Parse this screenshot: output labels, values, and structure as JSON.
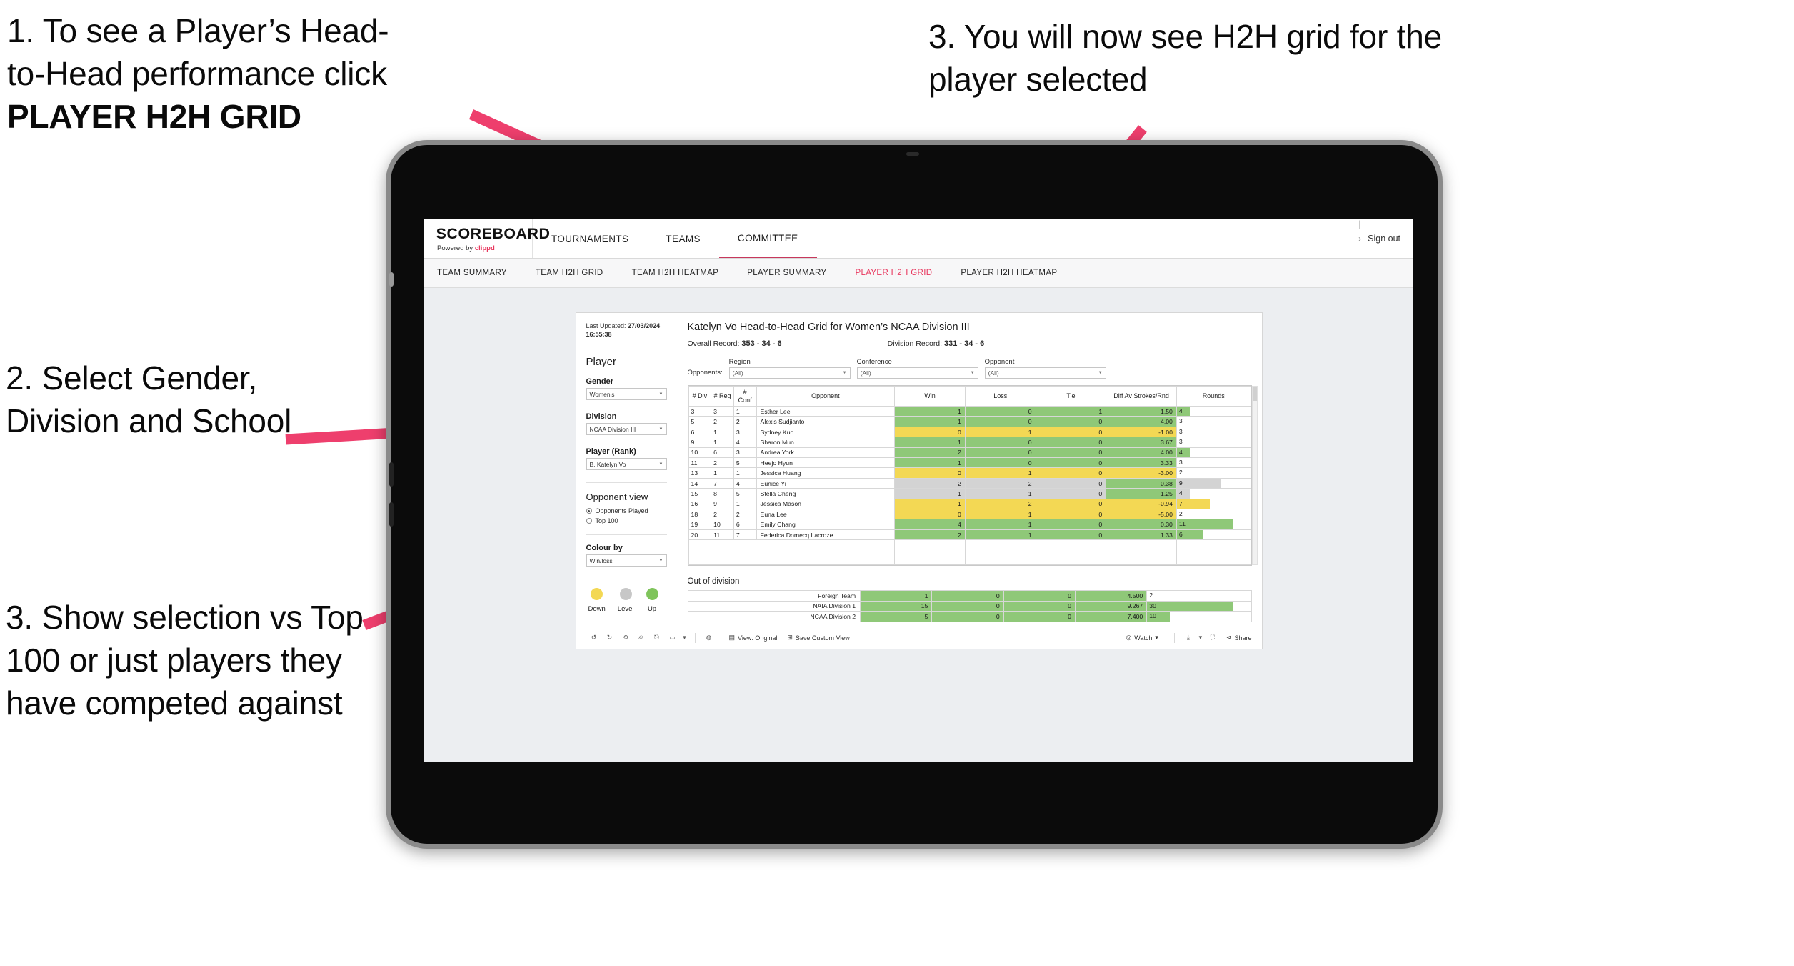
{
  "annotations": {
    "a1_line1": "1. To see a Player’s Head-",
    "a1_line2": "to-Head performance click",
    "a1_bold": "PLAYER H2H GRID",
    "a2": "2. Select Gender, Division and School",
    "a3": "3. Show selection vs Top 100 or just players they have competed against",
    "a4": "3. You will now see H2H grid for the player selected"
  },
  "app": {
    "brand_name": "SCOREBOARD",
    "brand_powered_prefix": "Powered by ",
    "brand_powered_name": "clippd",
    "top_nav": [
      {
        "label": "TOURNAMENTS",
        "active": false
      },
      {
        "label": "TEAMS",
        "active": false
      },
      {
        "label": "COMMITTEE",
        "active": true
      }
    ],
    "sign_out": "Sign out",
    "sub_nav": [
      {
        "label": "TEAM SUMMARY",
        "active": false
      },
      {
        "label": "TEAM H2H GRID",
        "active": false
      },
      {
        "label": "TEAM H2H HEATMAP",
        "active": false
      },
      {
        "label": "PLAYER SUMMARY",
        "active": false
      },
      {
        "label": "PLAYER H2H GRID",
        "active": true
      },
      {
        "label": "PLAYER H2H HEATMAP",
        "active": false
      }
    ],
    "accent_color": "#e8365d"
  },
  "sidebar": {
    "last_updated_label": "Last Updated: ",
    "last_updated_value": "27/03/2024 16:55:38",
    "player_section_title": "Player",
    "gender_label": "Gender",
    "gender_value": "Women's",
    "division_label": "Division",
    "division_value": "NCAA Division III",
    "player_rank_label": "Player (Rank)",
    "player_rank_value": "B. Katelyn Vo",
    "opponent_view_title": "Opponent view",
    "opponent_view_options": [
      {
        "label": "Opponents Played",
        "selected": true
      },
      {
        "label": "Top 100",
        "selected": false
      }
    ],
    "colour_by_label": "Colour by",
    "colour_by_value": "Win/loss",
    "legend": [
      {
        "label": "Down",
        "color": "#f3d854"
      },
      {
        "label": "Level",
        "color": "#c7c7c7"
      },
      {
        "label": "Up",
        "color": "#7fc45b"
      }
    ]
  },
  "main": {
    "title": "Katelyn Vo Head-to-Head Grid for Women’s NCAA Division III",
    "overall_record_label": "Overall Record: ",
    "overall_record_value": "353 -  34 - 6",
    "division_record_label": "Division Record: ",
    "division_record_value": "331 -  34 - 6",
    "opponents_label": "Opponents:",
    "filters": [
      {
        "label": "Region",
        "value": "(All)"
      },
      {
        "label": "Conference",
        "value": "(All)"
      },
      {
        "label": "Opponent",
        "value": "(All)"
      }
    ]
  },
  "chart_data": {
    "type": "table",
    "title": "Katelyn Vo Head-to-Head Grid for Women’s NCAA Division III",
    "columns": [
      "# Div",
      "# Reg",
      "# Conf",
      "Opponent",
      "Win",
      "Loss",
      "Tie",
      "Diff Av Strokes/Rnd",
      "Rounds"
    ],
    "rows": [
      {
        "div": "3",
        "reg": "3",
        "conf": "1",
        "opponent": "Esther Lee",
        "win": "1",
        "loss": "0",
        "tie": "1",
        "diff": "1.50",
        "rounds": "4",
        "state": "up",
        "rounds_pct": 18
      },
      {
        "div": "5",
        "reg": "2",
        "conf": "2",
        "opponent": "Alexis Sudjianto",
        "win": "1",
        "loss": "0",
        "tie": "0",
        "diff": "4.00",
        "rounds": "3",
        "state": "up",
        "rounds_pct": 0
      },
      {
        "div": "6",
        "reg": "1",
        "conf": "3",
        "opponent": "Sydney Kuo",
        "win": "0",
        "loss": "1",
        "tie": "0",
        "diff": "-1.00",
        "rounds": "3",
        "state": "down",
        "rounds_pct": 0
      },
      {
        "div": "9",
        "reg": "1",
        "conf": "4",
        "opponent": "Sharon Mun",
        "win": "1",
        "loss": "0",
        "tie": "0",
        "diff": "3.67",
        "rounds": "3",
        "state": "up",
        "rounds_pct": 0
      },
      {
        "div": "10",
        "reg": "6",
        "conf": "3",
        "opponent": "Andrea York",
        "win": "2",
        "loss": "0",
        "tie": "0",
        "diff": "4.00",
        "rounds": "4",
        "state": "up",
        "rounds_pct": 18
      },
      {
        "div": "11",
        "reg": "2",
        "conf": "5",
        "opponent": "Heejo Hyun",
        "win": "1",
        "loss": "0",
        "tie": "0",
        "diff": "3.33",
        "rounds": "3",
        "state": "up",
        "rounds_pct": 0
      },
      {
        "div": "13",
        "reg": "1",
        "conf": "1",
        "opponent": "Jessica Huang",
        "win": "0",
        "loss": "1",
        "tie": "0",
        "diff": "-3.00",
        "rounds": "2",
        "state": "down",
        "rounds_pct": 0
      },
      {
        "div": "14",
        "reg": "7",
        "conf": "4",
        "opponent": "Eunice Yi",
        "win": "2",
        "loss": "2",
        "tie": "0",
        "diff": "0.38",
        "rounds": "9",
        "state": "level",
        "rounds_pct": 60
      },
      {
        "div": "15",
        "reg": "8",
        "conf": "5",
        "opponent": "Stella Cheng",
        "win": "1",
        "loss": "1",
        "tie": "0",
        "diff": "1.25",
        "rounds": "4",
        "state": "level",
        "rounds_pct": 18
      },
      {
        "div": "16",
        "reg": "9",
        "conf": "1",
        "opponent": "Jessica Mason",
        "win": "1",
        "loss": "2",
        "tie": "0",
        "diff": "-0.94",
        "rounds": "7",
        "state": "down",
        "rounds_pct": 45
      },
      {
        "div": "18",
        "reg": "2",
        "conf": "2",
        "opponent": "Euna Lee",
        "win": "0",
        "loss": "1",
        "tie": "0",
        "diff": "-5.00",
        "rounds": "2",
        "state": "down",
        "rounds_pct": 0
      },
      {
        "div": "19",
        "reg": "10",
        "conf": "6",
        "opponent": "Emily Chang",
        "win": "4",
        "loss": "1",
        "tie": "0",
        "diff": "0.30",
        "rounds": "11",
        "state": "up",
        "rounds_pct": 76
      },
      {
        "div": "20",
        "reg": "11",
        "conf": "7",
        "opponent": "Federica Domecq Lacroze",
        "win": "2",
        "loss": "1",
        "tie": "0",
        "diff": "1.33",
        "rounds": "6",
        "state": "up",
        "rounds_pct": 36
      }
    ]
  },
  "out_of_division": {
    "title": "Out of division",
    "rows": [
      {
        "label": "Foreign Team",
        "win": "1",
        "loss": "0",
        "tie": "0",
        "diff": "4.500",
        "rounds": "2",
        "state": "up",
        "rounds_pct": 0
      },
      {
        "label": "NAIA Division 1",
        "win": "15",
        "loss": "0",
        "tie": "0",
        "diff": "9.267",
        "rounds": "30",
        "state": "up",
        "rounds_pct": 83
      },
      {
        "label": "NCAA Division 2",
        "win": "5",
        "loss": "0",
        "tie": "0",
        "diff": "7.400",
        "rounds": "10",
        "state": "up",
        "rounds_pct": 22
      }
    ]
  },
  "toolbar": {
    "view_original": "View: Original",
    "save_custom_view": "Save Custom View",
    "watch": "Watch",
    "share": "Share"
  }
}
